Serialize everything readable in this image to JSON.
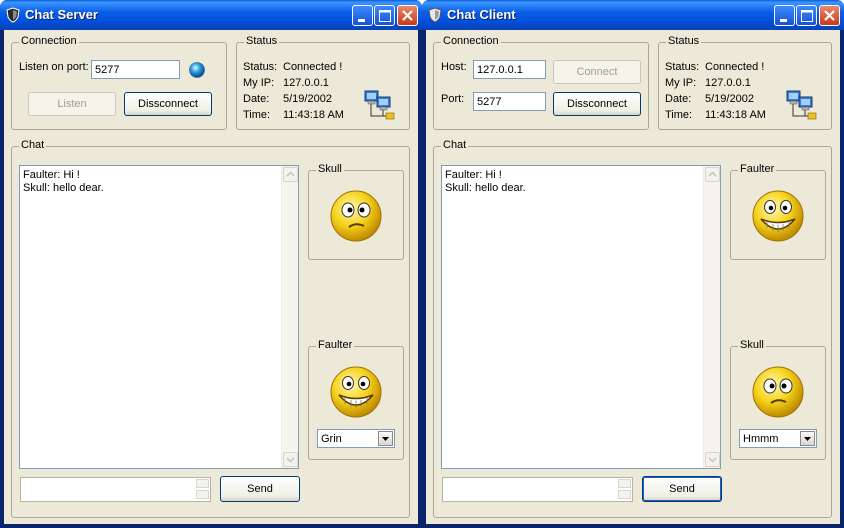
{
  "server": {
    "title": "Chat Server",
    "connection": {
      "group_label": "Connection",
      "port_label": "Listen on port:",
      "port_value": "5277",
      "listen_label": "Listen",
      "disconnect_label": "Dissconnect"
    },
    "status": {
      "group_label": "Status",
      "status_label": "Status:",
      "status_value": "Connected !",
      "ip_label": "My IP:",
      "ip_value": "127.0.0.1",
      "date_label": "Date:",
      "date_value": "5/19/2002",
      "time_label": "Time:",
      "time_value": "11:43:18 AM"
    },
    "chat": {
      "group_label": "Chat",
      "lines": [
        "Faulter: Hi !",
        "Skull: hello dear."
      ],
      "send_label": "Send",
      "message_value": ""
    },
    "remote_user": {
      "name": "Skull",
      "mood": "hmmm"
    },
    "local_user": {
      "name": "Faulter",
      "mood": "grin",
      "emotion_selected": "Grin"
    }
  },
  "client": {
    "title": "Chat Client",
    "connection": {
      "group_label": "Connection",
      "host_label": "Host:",
      "host_value": "127.0.0.1",
      "port_label": "Port:",
      "port_value": "5277",
      "connect_label": "Connect",
      "disconnect_label": "Dissconnect"
    },
    "status": {
      "group_label": "Status",
      "status_label": "Status:",
      "status_value": "Connected !",
      "ip_label": "My IP:",
      "ip_value": "127.0.0.1",
      "date_label": "Date:",
      "date_value": "5/19/2002",
      "time_label": "Time:",
      "time_value": "11:43:18 AM"
    },
    "chat": {
      "group_label": "Chat",
      "lines": [
        "Faulter: Hi !",
        "Skull: hello dear."
      ],
      "send_label": "Send",
      "message_value": ""
    },
    "remote_user": {
      "name": "Faulter",
      "mood": "grin"
    },
    "local_user": {
      "name": "Skull",
      "mood": "hmmm",
      "emotion_selected": "Hmmm"
    }
  },
  "colors": {
    "titlebar": "#0a5fe6",
    "dialog_bg": "#ece9d8",
    "close_button": "#c8391a",
    "indicator_led": "#2aa0e0",
    "smiley_yellow": "#f6d21a"
  },
  "icons": {
    "app_icon": "shield-icon",
    "network_icon": "network-computers-icon",
    "minimize": "minimize-icon",
    "maximize": "maximize-icon",
    "close": "close-icon"
  }
}
